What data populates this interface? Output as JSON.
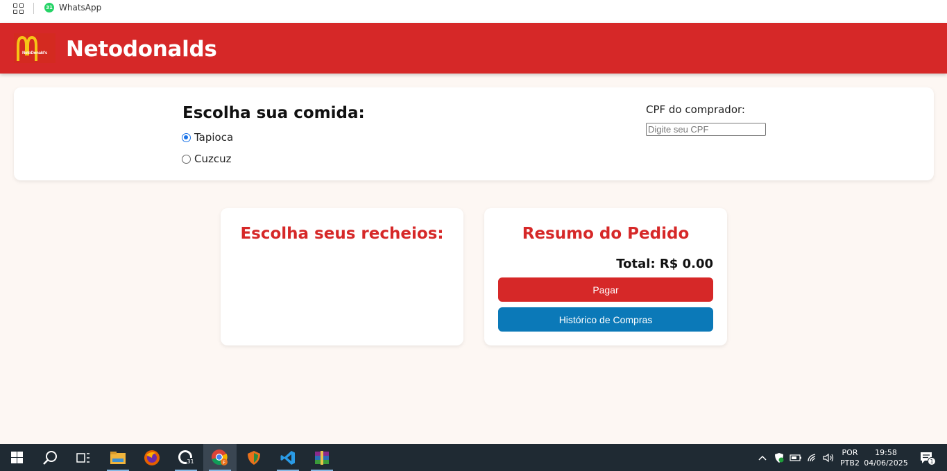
{
  "bookmarks": {
    "apps_icon": "apps-grid-icon",
    "items": [
      {
        "label": "WhatsApp",
        "badge": "31",
        "icon": "whatsapp-icon"
      }
    ]
  },
  "header": {
    "logo_text": "NetoDonald's",
    "title": "Netodonalds",
    "color": "#d62828"
  },
  "food": {
    "title": "Escolha sua comida:",
    "options": [
      {
        "label": "Tapioca",
        "selected": true
      },
      {
        "label": "Cuzcuz",
        "selected": false
      }
    ],
    "cpf_label": "CPF do comprador:",
    "cpf_value": "",
    "cpf_placeholder": "Digite seu CPF"
  },
  "fillings": {
    "title": "Escolha seus recheios:"
  },
  "summary": {
    "title": "Resumo do Pedido",
    "total": "Total: R$ 0.00",
    "pay_label": "Pagar",
    "history_label": "Histórico de Compras",
    "pay_color": "#d62828",
    "history_color": "#0b79b8"
  },
  "taskbar": {
    "apps": [
      "windows-start-icon",
      "search-icon",
      "task-view-icon",
      "file-explorer-icon",
      "firefox-icon",
      "whatsapp-icon",
      "chrome-icon",
      "openvpn-icon",
      "vscode-icon",
      "winrar-icon"
    ],
    "whatsapp_badge": "31",
    "chrome_badge": "F",
    "language": "POR",
    "layout": "PTB2",
    "time": "19:58",
    "date": "04/06/2025",
    "notifications": "1"
  }
}
